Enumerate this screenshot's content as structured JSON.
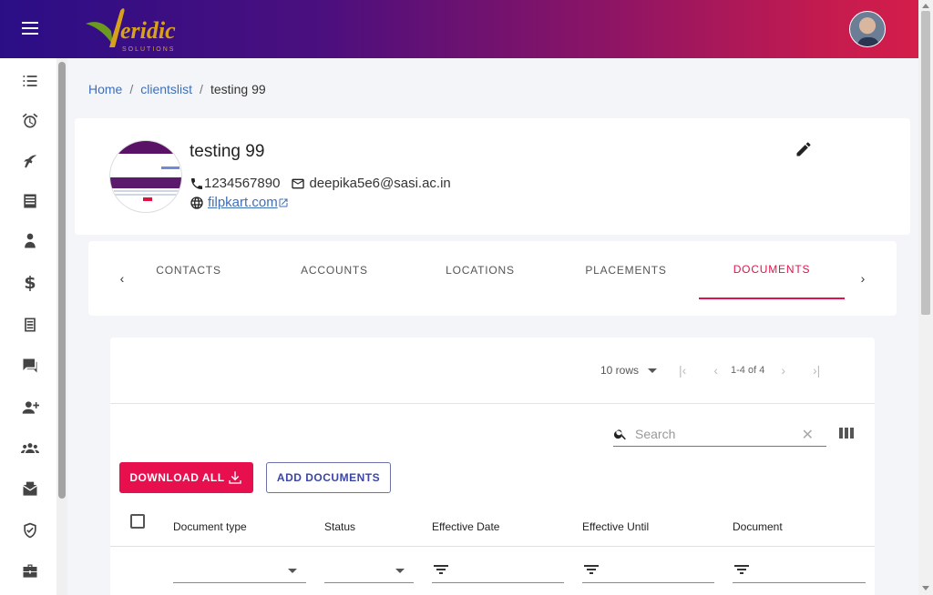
{
  "header": {
    "logo_alt": "Veridic Solutions"
  },
  "sidebar": {
    "icons": [
      "checklist-icon",
      "alarm-icon",
      "flight-icon",
      "list-icon",
      "person-tie-icon",
      "dollar-icon",
      "document-icon",
      "chat-icon",
      "add-user-icon",
      "group-icon",
      "mail-icon",
      "shield-check-icon",
      "briefcase-icon"
    ],
    "dollar_glyph": "$"
  },
  "breadcrumb": {
    "home": "Home",
    "clients": "clientslist",
    "current": "testing 99",
    "sep": "/"
  },
  "profile": {
    "name": "testing 99",
    "phone": "1234567890",
    "email": "deepika5e6@sasi.ac.in",
    "website": "filpkart.com"
  },
  "tabs": {
    "items": [
      "CONTACTS",
      "ACCOUNTS",
      "LOCATIONS",
      "PLACEMENTS",
      "DOCUMENTS"
    ],
    "active": "DOCUMENTS",
    "prev": "‹",
    "next": "›"
  },
  "pagination": {
    "rows_label": "10 rows",
    "range": "1-4 of 4",
    "first": "|‹",
    "prev": "‹",
    "next": "›",
    "last": "›|"
  },
  "search": {
    "placeholder": "Search",
    "clear": "✕"
  },
  "buttons": {
    "download_all": "DOWNLOAD ALL",
    "add_documents": "ADD DOCUMENTS"
  },
  "table": {
    "columns": [
      "Document type",
      "Status",
      "Effective Date",
      "Effective Until",
      "Document"
    ]
  },
  "colors": {
    "accent": "#e80f4f",
    "link": "#3f6fb5",
    "secondary_button": "#3b46a8"
  }
}
